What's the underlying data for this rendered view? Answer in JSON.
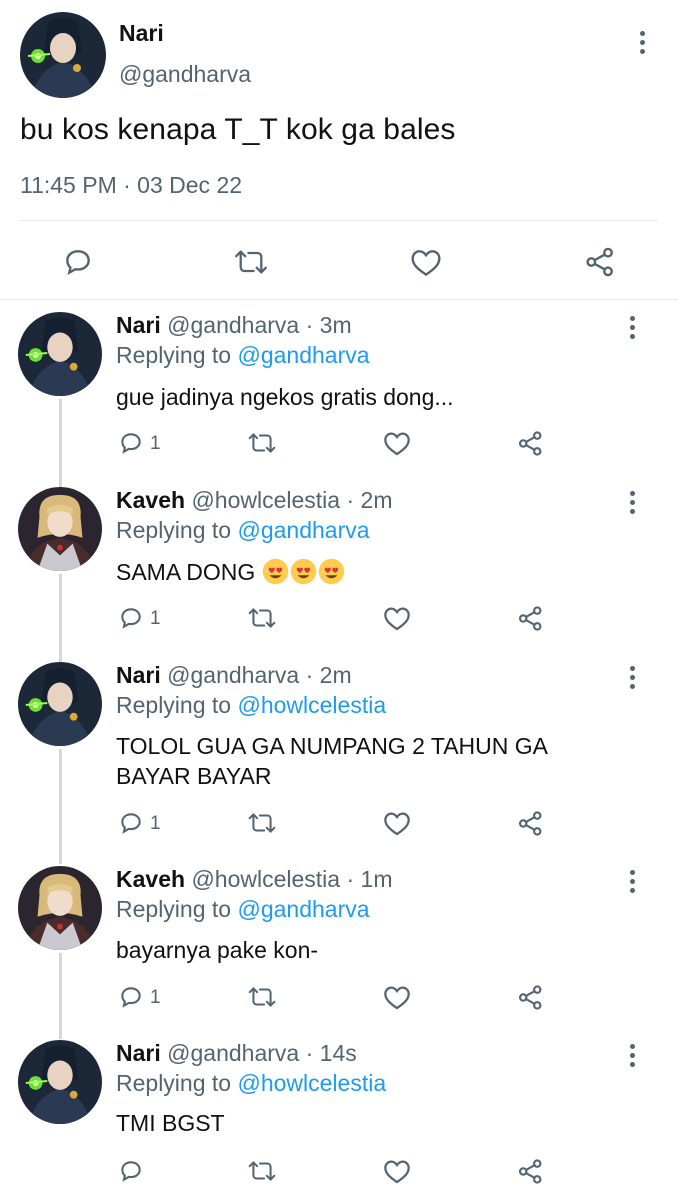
{
  "main_tweet": {
    "name": "Nari",
    "handle": "@gandharva",
    "text": "bu kos kenapa T_T kok ga bales",
    "timestamp": "11:45 PM · 03 Dec 22",
    "avatar": "nari-avatar",
    "actions": [
      "reply-icon",
      "retweet-icon",
      "like-icon",
      "share-icon"
    ]
  },
  "replies": [
    {
      "name": "Nari",
      "handle": "@gandharva",
      "time": "3m",
      "replying_label": "Replying to",
      "replying_to": "@gandharva",
      "text": "gue jadinya ngekos gratis dong...",
      "reply_count": "1"
    },
    {
      "name": "Kaveh",
      "handle": "@howlcelestia",
      "time": "2m",
      "replying_label": "Replying to",
      "replying_to": "@gandharva",
      "text": "SAMA DONG",
      "emojis": [
        "heart-eyes-emoji",
        "heart-eyes-emoji",
        "heart-eyes-emoji"
      ],
      "reply_count": "1"
    },
    {
      "name": "Nari",
      "handle": "@gandharva",
      "time": "2m",
      "replying_label": "Replying to",
      "replying_to": "@howlcelestia",
      "text": "TOLOL GUA GA NUMPANG 2 TAHUN GA BAYAR BAYAR",
      "reply_count": "1"
    },
    {
      "name": "Kaveh",
      "handle": "@howlcelestia",
      "time": "1m",
      "replying_label": "Replying to",
      "replying_to": "@gandharva",
      "text": "bayarnya pake kon-",
      "reply_count": "1"
    },
    {
      "name": "Nari",
      "handle": "@gandharva",
      "time": "14s",
      "replying_label": "Replying to",
      "replying_to": "@howlcelestia",
      "text": "TMI BGST",
      "reply_count": ""
    }
  ],
  "colors": {
    "link": "#1d9bf0",
    "secondary": "#536471",
    "thread_line": "#cfd9de"
  },
  "separator": " · "
}
